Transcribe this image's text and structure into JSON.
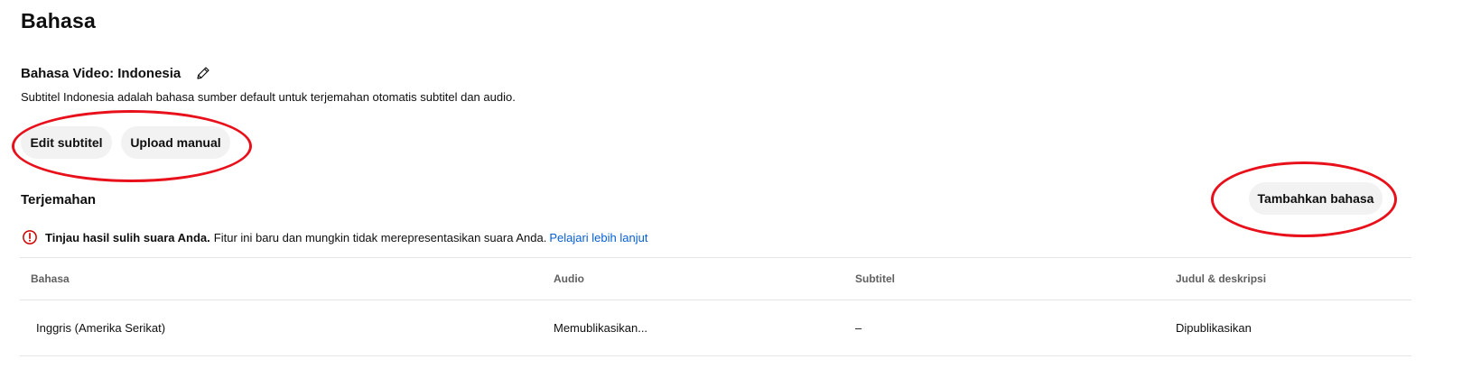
{
  "page": {
    "title": "Bahasa"
  },
  "video_language": {
    "label": "Bahasa Video: Indonesia",
    "edit_icon": "pencil-icon",
    "description": "Subtitel Indonesia adalah bahasa sumber default untuk terjemahan otomatis subtitel dan audio."
  },
  "actions": {
    "edit_subtitle": "Edit subtitel",
    "upload_manual": "Upload manual"
  },
  "translations": {
    "title": "Terjemahan",
    "add_language": "Tambahkan bahasa"
  },
  "notice": {
    "icon": "alert-circle-icon",
    "strong": "Tinjau hasil sulih suara Anda.",
    "text": "Fitur ini baru dan mungkin tidak merepresentasikan suara Anda.",
    "link": "Pelajari lebih lanjut"
  },
  "table": {
    "headers": {
      "language": "Bahasa",
      "audio": "Audio",
      "subtitle": "Subtitel",
      "title_desc": "Judul & deskripsi"
    },
    "rows": [
      {
        "language": "Inggris (Amerika Serikat)",
        "audio": "Memublikasikan...",
        "subtitle": "–",
        "title_desc": "Dipublikasikan"
      }
    ]
  },
  "colors": {
    "annotation_red": "#e8101a",
    "button_bg": "#f2f2f2",
    "link_blue": "#065fd4",
    "alert_red": "#cc0000"
  }
}
